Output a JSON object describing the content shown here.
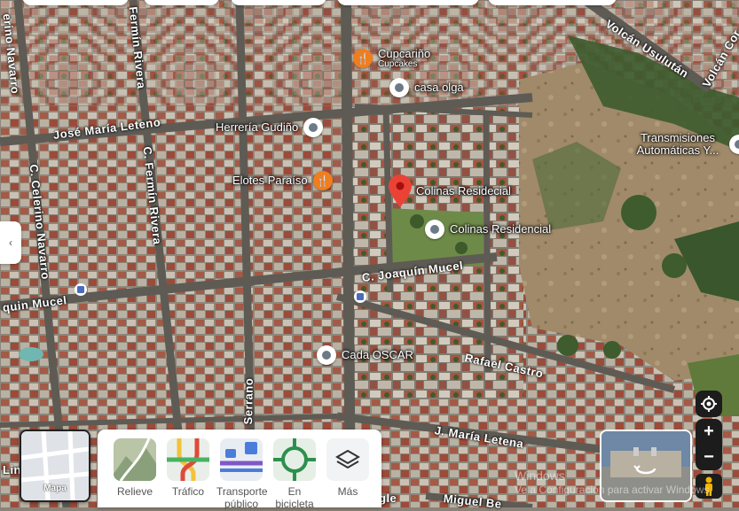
{
  "streets": [
    {
      "id": "jose-maria-leteno",
      "text": "José María Leteno"
    },
    {
      "id": "c-fermin-rivera",
      "text": "C. Fermín Rivera"
    },
    {
      "id": "c-celerino-navarro",
      "text": "C. Celerino Navarro"
    },
    {
      "id": "c-joaquin-mucel",
      "text": "C. Joaquín Mucel"
    },
    {
      "id": "joaquin-mucel-west",
      "text": "quin Mucel"
    },
    {
      "id": "francisco-r-serrano",
      "text": "Francisco R. Serrano"
    },
    {
      "id": "rafael-castro",
      "text": "Rafael Castro"
    },
    {
      "id": "j-maria-letena",
      "text": "J. María Letena"
    },
    {
      "id": "volcan-usulutan",
      "text": "Volcán Usulután"
    },
    {
      "id": "volcan-top-right",
      "text": "Volcán Cor"
    },
    {
      "id": "miguel-be",
      "text": "Miguel Be"
    },
    {
      "id": "celerino-top",
      "text": "erino Navarro"
    },
    {
      "id": "fermin-top",
      "text": "Fermín Rivera"
    },
    {
      "id": "lin-partial",
      "text": "Lin"
    },
    {
      "id": "gle-partial",
      "text": "gle"
    }
  ],
  "places": {
    "cupcarino": {
      "name": "Cupcariño",
      "sub": "Cupcakes"
    },
    "casa_olga": {
      "name": "casa olga"
    },
    "herreria": {
      "name": "Herrería Gudiño"
    },
    "elotes": {
      "name": "Elotes Paraíso"
    },
    "colinas_pin": {
      "name": "Colinas Residecial"
    },
    "colinas": {
      "name": "Colinas Residencial"
    },
    "transmisiones": {
      "name": "Transmisiones Automáticas Y..."
    },
    "cada_oscar": {
      "name": "Cada OSCAR"
    }
  },
  "layers": {
    "current": "Mapa",
    "options": [
      {
        "id": "relieve",
        "label": "Relieve"
      },
      {
        "id": "trafico",
        "label": "Tráfico"
      },
      {
        "id": "transporte",
        "label": "Transporte público"
      },
      {
        "id": "bicicleta",
        "label": "En bicicleta"
      },
      {
        "id": "mas",
        "label": "Más"
      }
    ]
  },
  "controls": {
    "zoom_in": "+",
    "zoom_out": "−",
    "collapse": "‹"
  },
  "watermark": {
    "line1": "Windows",
    "line2": "Ve a Configuración para activar Windows."
  },
  "colors": {
    "pin_red": "#ea4335",
    "poi_orange": "#f07d1e",
    "poi_grey": "#6b7a86"
  }
}
